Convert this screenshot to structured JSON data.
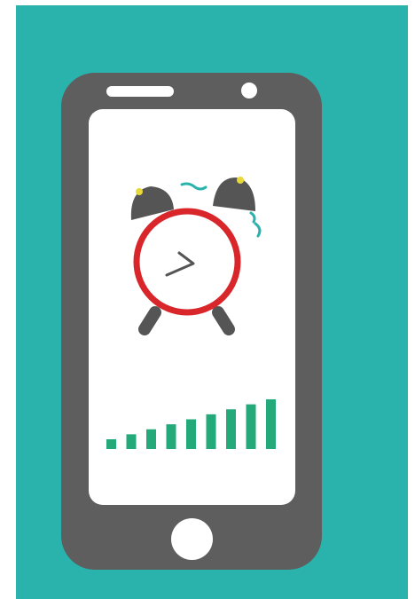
{
  "colors": {
    "background": "#2ab3ac",
    "phone": "#5e5e5e",
    "screen": "#ffffff",
    "clock_ring": "#d8262b",
    "bells": "#555555",
    "bell_knobs": "#e8d838",
    "hands": "#555555",
    "signal_bars": "#23a97a",
    "vibration": "#2ab3ac"
  },
  "icons": {
    "clock": "alarm-clock-icon",
    "signal": "signal-strength-icon"
  },
  "signal": {
    "total_bars": 9,
    "filled_bars": 9
  }
}
